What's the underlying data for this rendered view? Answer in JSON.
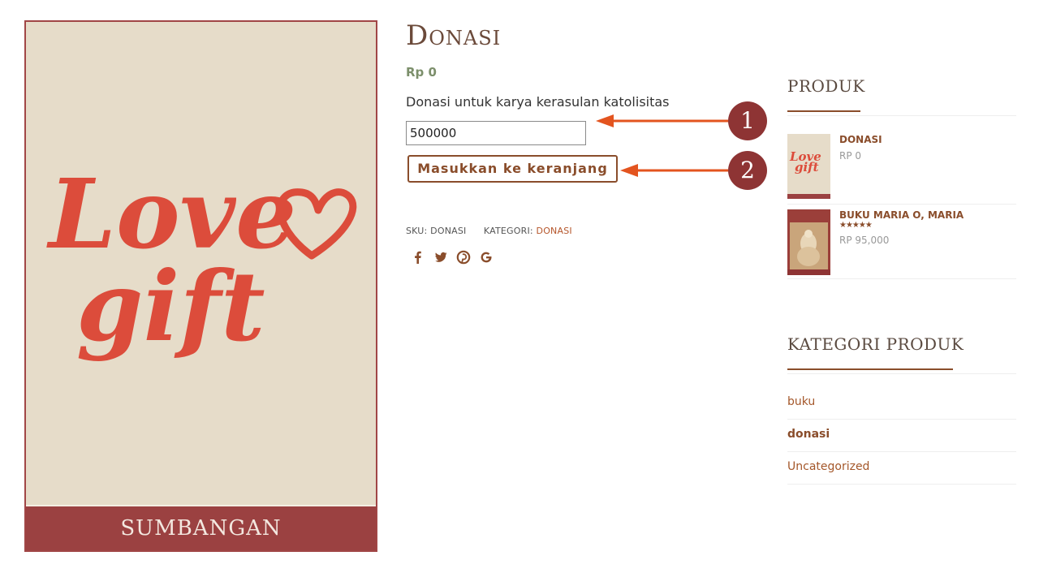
{
  "product": {
    "title": "Donasi",
    "price": "Rp 0",
    "description": "Donasi untuk karya kerasulan katolisitas",
    "donation_value": "500000",
    "add_to_cart_label": "Masukkan ke keranjang",
    "image_caption_line1": "Love",
    "image_caption_line2": "gift",
    "image_footer": "SUMBANGAN",
    "meta": {
      "sku_label": "SKU:",
      "sku_value": "DONASI",
      "category_label": "KATEGORI:",
      "category_value": "DONASI"
    },
    "share_icons": [
      {
        "name": "facebook-icon",
        "glyph": "f"
      },
      {
        "name": "twitter-icon",
        "glyph": "ᵮ"
      },
      {
        "name": "pinterest-icon",
        "glyph": "℗"
      },
      {
        "name": "google-icon",
        "glyph": "G"
      }
    ]
  },
  "callouts": [
    "1",
    "2"
  ],
  "sidebar": {
    "products_title": "PRODUK",
    "products": [
      {
        "name": "DONASI",
        "price": "RP 0",
        "rating": 0
      },
      {
        "name": "BUKU MARIA O, MARIA",
        "price": "RP 95,000",
        "rating": 5,
        "stars": "★★★★★"
      }
    ],
    "categories_title": "KATEGORI PRODUK",
    "categories": [
      {
        "label": "buku",
        "active": false
      },
      {
        "label": "donasi",
        "active": true
      },
      {
        "label": "Uncategorized",
        "active": false
      }
    ]
  },
  "colors": {
    "accent": "#8a4d2b",
    "callout": "#8e3434",
    "arrow": "#e3541f",
    "image_bg": "#e6dcc9",
    "image_script": "#dc4c3b",
    "image_footer": "#9b4141"
  }
}
